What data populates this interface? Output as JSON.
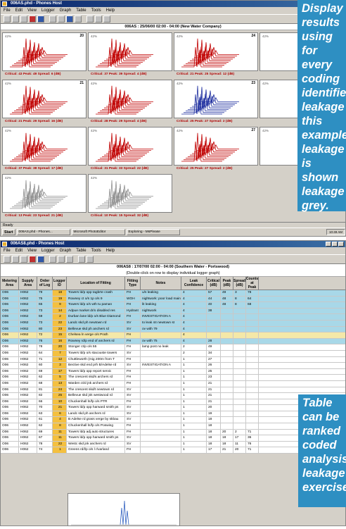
{
  "top_window": {
    "title": "006AS.phd - Phones Host",
    "menu": [
      "File",
      "Edit",
      "View",
      "Logger",
      "Graph",
      "Table",
      "Tools",
      "Help"
    ],
    "chart_title": "006AS : 25/06/00 02:00 - 04:00 (New Water Company)",
    "status": "Ready",
    "charts": [
      {
        "n": "20",
        "cap": "Critical: 43 Peak: 49 Spread: 6 (dB)",
        "c": "#c00000"
      },
      {
        "n": "",
        "cap": "Critical: 37 Peak: 39 Spread: 4 (dB)",
        "c": "#c00000"
      },
      {
        "n": "24",
        "cap": "Critical: 21 Peak: 25 Spread: 12 (dB)",
        "c": "#c00000"
      },
      {
        "n": "",
        "cap": "",
        "c": "#c00000"
      },
      {
        "n": "21",
        "cap": "Critical: 21 Peak: 29 Spread: 16 (dB)",
        "c": "#c00000"
      },
      {
        "n": "",
        "cap": "Critical: 28 Peak: 29 Spread: 4 (dB)",
        "c": "#c00000"
      },
      {
        "n": "23",
        "cap": "Critical: 25 Peak: 27 Spread: 2 (dB)",
        "c": "#2030a0"
      },
      {
        "n": "",
        "cap": "",
        "c": "#c00000"
      },
      {
        "n": "",
        "cap": "Critical: 37 Peak: 38 Spread: 17 (dB)",
        "c": "#c00000"
      },
      {
        "n": "",
        "cap": "Critical: 31 Peak: 33 Spread: 22 (dB)",
        "c": "#c00000"
      },
      {
        "n": "27",
        "cap": "Critical: 25 Peak: 27 Spread: 2 (dB)",
        "c": "#c00000"
      },
      {
        "n": "",
        "cap": "",
        "c": "#20a020"
      },
      {
        "n": "",
        "cap": "Critical: 13 Peak: 23 Spread: 21 (dB)",
        "c": "#909090"
      },
      {
        "n": "",
        "cap": "Critical: 10 Peak: 15 Spread: 32 (dB)",
        "c": "#909090"
      }
    ],
    "level_label": "42%",
    "taskbar": {
      "start": "Start",
      "tasks": [
        "006AS.phd - Phones...",
        "Microsoft PhotoEditor",
        "Exploring - MsPlease"
      ],
      "tray": "10:49 AM"
    }
  },
  "bottom_window": {
    "title": "006AS8.phd - Phones Host",
    "menu": [
      "File",
      "Edit",
      "View",
      "Logger",
      "Graph",
      "Table",
      "Tools",
      "Help"
    ],
    "table_title": "006AS8 : 17/07/00 02:00 - 04:00 (Southern Water - Portswood)",
    "table_subtitle": "(Double-click on row to display individual logger graph)",
    "headers": [
      "Metering Area",
      "Supply Area",
      "Order of Log",
      "Logger ID",
      "Location of Fitting",
      "Fitting Type",
      "Notes",
      "Leak Confidence",
      "Critical (dB)",
      "Peak (dB)",
      "Spread (dB)",
      "Counts at Peak"
    ],
    "rows": [
      [
        "O06",
        "H062",
        "79",
        "18",
        "Towers ld/p opp tagbrte crash",
        "FH",
        "u/s leaking",
        "4",
        "57",
        "49",
        "3",
        "78",
        "lk"
      ],
      [
        "O06",
        "H062",
        "75",
        "19",
        "Rowney ct o/s 1p o/s 9",
        "WOH",
        "nightwork: poor load main",
        "4",
        "44",
        "48",
        "8",
        "64",
        "lk"
      ],
      [
        "O06",
        "H062",
        "65",
        "9",
        "Towers ld/p o/s wth tu paman",
        "FH",
        "lit leaking",
        "4",
        "40",
        "48",
        "8",
        "68",
        "lk"
      ],
      [
        "O06",
        "H062",
        "73",
        "14",
        "Adpue market dr/o disabled res",
        "Hydrant",
        "nightwork",
        "4",
        "38",
        "",
        "",
        "",
        "lk"
      ],
      [
        "O06",
        "H062",
        "59",
        "2",
        "Durban lane ld/p o/s Blue Diamond",
        "FH",
        "INVESTIGATION A",
        "4",
        "",
        "",
        "",
        "",
        "lk"
      ],
      [
        "O06",
        "H062",
        "73",
        "22",
        "Landc skd ph newtown rd",
        "SV",
        "to leak 44 newtown st",
        "4",
        "",
        "",
        "",
        "",
        "lk"
      ],
      [
        "O06",
        "H062",
        "80",
        "23",
        "Bellevue skd ph anchers rd",
        "SV",
        "ov with 79",
        "4",
        "",
        "",
        "",
        "",
        "lk"
      ],
      [
        "O06",
        "H062",
        "72",
        "15",
        "Chelsea ln verge o/s Prath",
        "FH",
        "",
        "4",
        "",
        "",
        "",
        "",
        "sel"
      ],
      [
        "O06",
        "H062",
        "76",
        "16",
        "Rowney rd/p end of anchers rd",
        "FH",
        "ov with 75",
        "4",
        "28",
        "",
        "",
        "",
        "lk"
      ],
      [
        "O06",
        "H062",
        "78",
        "20",
        "Stonger ct/p o/s 55",
        "FH",
        "lamp post no leak",
        "2",
        "49",
        "",
        "",
        "",
        ""
      ],
      [
        "O06",
        "H062",
        "64",
        "7",
        "Towers ld/p o/s stacouste towers",
        "SV",
        "",
        "2",
        "34",
        "",
        "",
        "",
        ""
      ],
      [
        "O06",
        "H062",
        "71",
        "12",
        "Chuttleworth (mig 200m from T",
        "FH",
        "",
        "1",
        "27",
        "",
        "",
        "",
        ""
      ],
      [
        "O06",
        "H062",
        "60",
        "3",
        "Bective skd end prh B/Adelse rd",
        "SV",
        "INVESTIGATION A",
        "1",
        "26",
        "",
        "",
        "",
        ""
      ],
      [
        "O06",
        "H062",
        "69",
        "17",
        "Towers ld/p opp report servic",
        "FH",
        "",
        "1",
        "25",
        "",
        "",
        "",
        ""
      ],
      [
        "O06",
        "H062",
        "62",
        "5",
        "The crescent skd/s archers rd",
        "FH",
        "",
        "1",
        "23",
        "",
        "",
        "",
        ""
      ],
      [
        "O06",
        "H062",
        "68",
        "13",
        "Warden ct/d jnk archers rd",
        "FH",
        "",
        "1",
        "21",
        "",
        "",
        "",
        ""
      ],
      [
        "O06",
        "H062",
        "81",
        "24",
        "The crescent skd/t newtown rd",
        "SV",
        "",
        "1",
        "21",
        "",
        "",
        "",
        ""
      ],
      [
        "O06",
        "H062",
        "82",
        "25",
        "Bellevue skd jnk westwood rd",
        "SV",
        "",
        "1",
        "21",
        "",
        "",
        "",
        ""
      ],
      [
        "O06",
        "H062",
        "66",
        "10",
        "Chuckenhall ln/fp o/s PTR",
        "FH",
        "",
        "1",
        "21",
        "",
        "",
        "",
        ""
      ],
      [
        "O06",
        "H062",
        "70",
        "21",
        "Towers ld/p opp harward smith ps",
        "SV",
        "",
        "1",
        "20",
        "",
        "",
        "",
        ""
      ],
      [
        "O06",
        "H062",
        "63",
        "6",
        "Landc skd ph anchers rd",
        "SV",
        "",
        "1",
        "19",
        "",
        "",
        "",
        ""
      ],
      [
        "O06",
        "H062",
        "61",
        "4",
        "B Adelse rd grass verge by skbau",
        "SV",
        "",
        "1",
        "18",
        "",
        "",
        "",
        ""
      ],
      [
        "O06",
        "H062",
        "62",
        "8",
        "Chuckenhall ln/fp o/s Poswing",
        "FH",
        "",
        "1",
        "18",
        "",
        "",
        "",
        ""
      ],
      [
        "O06",
        "H062",
        "69",
        "11",
        "Towers ld/p adj auto structures",
        "FH",
        "",
        "1",
        "18",
        "20",
        "2",
        "71",
        ""
      ],
      [
        "O06",
        "H062",
        "67",
        "11",
        "Towers ld/p opp harward smith ps",
        "SV",
        "",
        "1",
        "18",
        "18",
        "17",
        "36",
        ""
      ],
      [
        "O06",
        "H062",
        "78",
        "22",
        "Westc skd jnk anchers rd",
        "SV",
        "",
        "1",
        "18",
        "18",
        "11",
        "76",
        ""
      ],
      [
        "O06",
        "H062",
        "74",
        "1",
        "Greens rd/l/p o/s l r/varland",
        "FH",
        "",
        "1",
        "17",
        "21",
        "20",
        "71",
        ""
      ]
    ],
    "status": "Ready"
  },
  "callouts": {
    "top": "Display results using for every coding identifies leakage this example leakage is shown leakage grey.",
    "bottom": "Table can be ranked coded analysis leakage exercise"
  }
}
